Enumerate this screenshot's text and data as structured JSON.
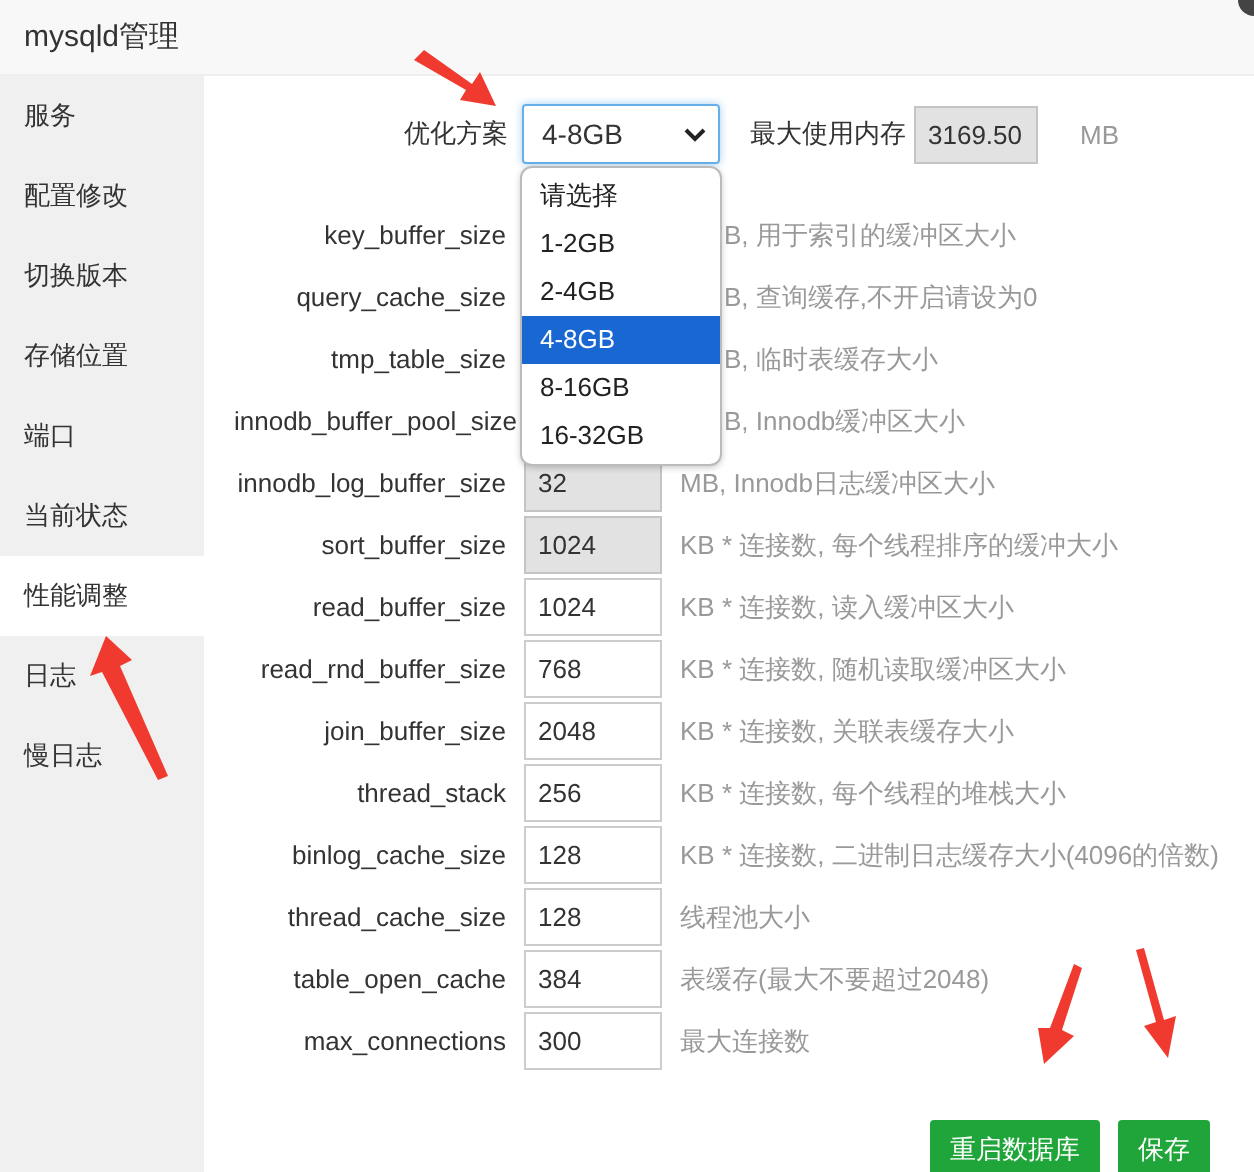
{
  "window": {
    "title": "mysqld管理"
  },
  "sidebar": {
    "items": [
      {
        "label": "服务",
        "selected": false
      },
      {
        "label": "配置修改",
        "selected": false
      },
      {
        "label": "切换版本",
        "selected": false
      },
      {
        "label": "存储位置",
        "selected": false
      },
      {
        "label": "端口",
        "selected": false
      },
      {
        "label": "当前状态",
        "selected": false
      },
      {
        "label": "性能调整",
        "selected": true
      },
      {
        "label": "日志",
        "selected": false
      },
      {
        "label": "慢日志",
        "selected": false
      }
    ]
  },
  "scheme": {
    "label": "优化方案",
    "value": "4-8GB",
    "expanded": true,
    "options": [
      {
        "label": "请选择",
        "selected": false
      },
      {
        "label": "1-2GB",
        "selected": false
      },
      {
        "label": "2-4GB",
        "selected": false
      },
      {
        "label": "4-8GB",
        "selected": true
      },
      {
        "label": "8-16GB",
        "selected": false
      },
      {
        "label": "16-32GB",
        "selected": false
      }
    ]
  },
  "max_memory": {
    "label": "最大使用内存",
    "value": "3169.50",
    "unit": "MB"
  },
  "settings": [
    {
      "name": "key_buffer_size",
      "description": "B, 用于索引的缓冲区大小"
    },
    {
      "name": "query_cache_size",
      "description": "B, 查询缓存,不开启请设为0"
    },
    {
      "name": "tmp_table_size",
      "description": "B, 临时表缓存大小"
    },
    {
      "name": "innodb_buffer_pool_size",
      "description": "B, Innodb缓冲区大小"
    },
    {
      "name": "innodb_log_buffer_size",
      "disabled": true,
      "value": "32",
      "description": "MB, Innodb日志缓冲区大小"
    },
    {
      "name": "sort_buffer_size",
      "disabled": true,
      "value": "1024",
      "description": "KB * 连接数, 每个线程排序的缓冲大小"
    },
    {
      "name": "read_buffer_size",
      "disabled": false,
      "value": "1024",
      "description": "KB * 连接数, 读入缓冲区大小"
    },
    {
      "name": "read_rnd_buffer_size",
      "disabled": false,
      "value": "768",
      "description": "KB * 连接数, 随机读取缓冲区大小"
    },
    {
      "name": "join_buffer_size",
      "disabled": false,
      "value": "2048",
      "description": "KB * 连接数, 关联表缓存大小"
    },
    {
      "name": "thread_stack",
      "disabled": false,
      "value": "256",
      "description": "KB * 连接数, 每个线程的堆栈大小"
    },
    {
      "name": "binlog_cache_size",
      "disabled": false,
      "value": "128",
      "description": "KB * 连接数, 二进制日志缓存大小(4096的倍数)"
    },
    {
      "name": "thread_cache_size",
      "disabled": false,
      "value": "128",
      "description": "线程池大小"
    },
    {
      "name": "table_open_cache",
      "disabled": false,
      "value": "384",
      "description": "表缓存(最大不要超过2048)"
    },
    {
      "name": "max_connections",
      "disabled": false,
      "value": "300",
      "description": "最大连接数"
    }
  ],
  "buttons": [
    "重启数据库",
    "保存"
  ]
}
